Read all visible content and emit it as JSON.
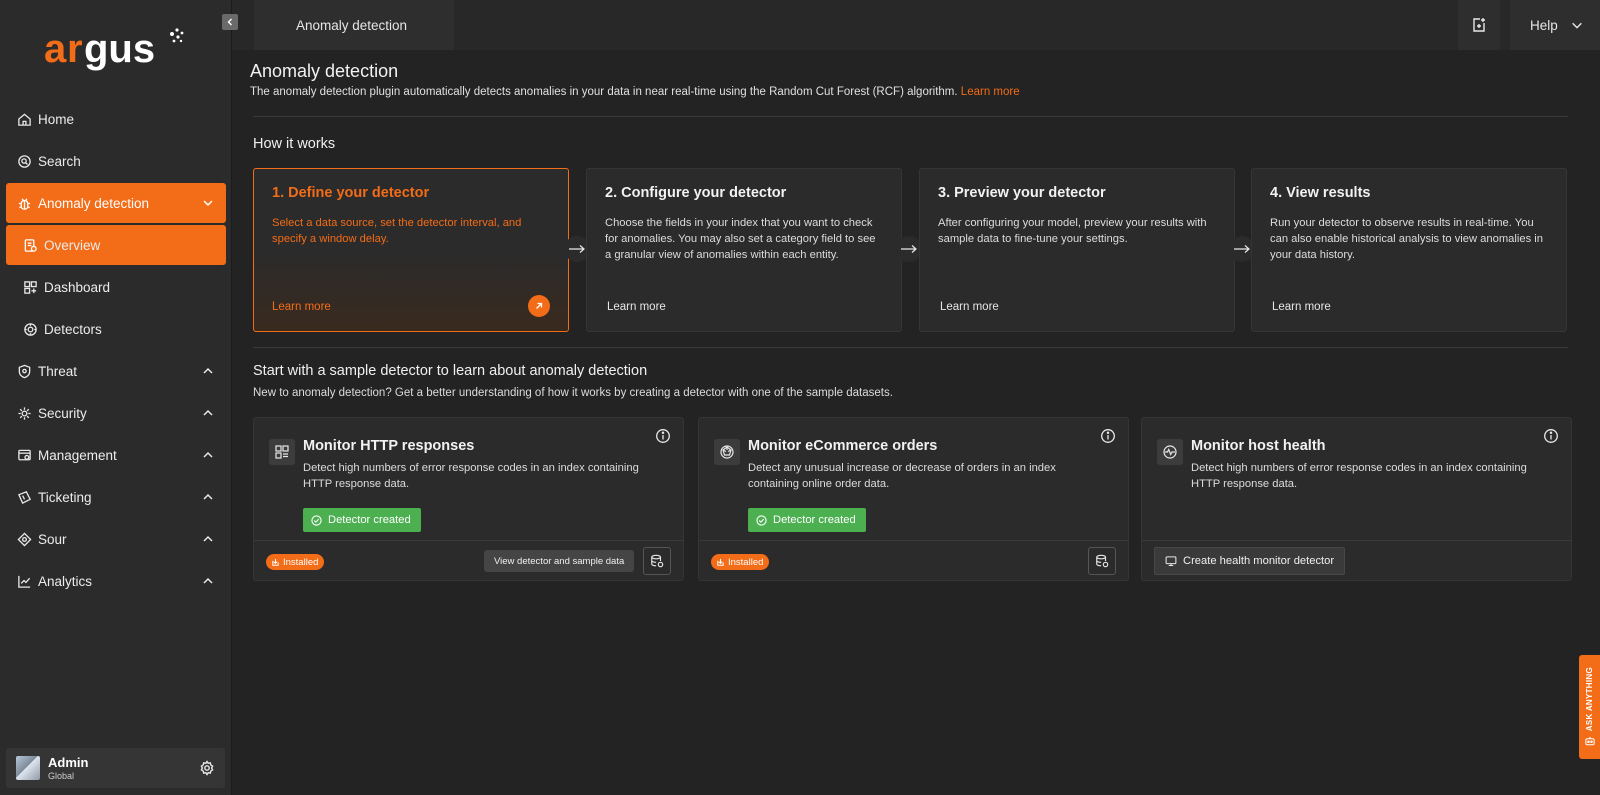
{
  "app": {
    "logo_text": "argus"
  },
  "sidebar": {
    "items": [
      {
        "label": "Home",
        "icon": "home-icon"
      },
      {
        "label": "Search",
        "icon": "search-icon"
      },
      {
        "label": "Anomaly detection",
        "icon": "bug-icon",
        "expanded": true
      },
      {
        "label": "Overview",
        "icon": "overview-icon"
      },
      {
        "label": "Dashboard",
        "icon": "dashboard-icon"
      },
      {
        "label": "Detectors",
        "icon": "detectors-icon"
      },
      {
        "label": "Threat",
        "icon": "shield-icon"
      },
      {
        "label": "Security",
        "icon": "security-icon"
      },
      {
        "label": "Management",
        "icon": "management-icon"
      },
      {
        "label": "Ticketing",
        "icon": "ticket-icon"
      },
      {
        "label": "Sour",
        "icon": "source-icon"
      },
      {
        "label": "Analytics",
        "icon": "analytics-icon"
      }
    ],
    "user": {
      "name": "Admin",
      "role": "Global"
    }
  },
  "topbar": {
    "tab_label": "Anomaly detection",
    "help_label": "Help"
  },
  "main": {
    "title": "Anomaly detection",
    "description": "The anomaly detection plugin automatically detects anomalies in your data in near real-time using the Random Cut Forest (RCF) algorithm.",
    "description_link": "Learn more",
    "how_title": "How it works",
    "steps": [
      {
        "title": "1. Define your detector",
        "text": "Select a data source, set the detector interval, and specify a window delay.",
        "link": "Learn more"
      },
      {
        "title": "2. Configure your detector",
        "text": "Choose the fields in your index that you want to check for anomalies. You may also set a category field to see a granular view of anomalies within each entity.",
        "link": "Learn more"
      },
      {
        "title": "3. Preview your detector",
        "text": "After configuring your model, preview your results with sample data to fine-tune your settings.",
        "link": "Learn more"
      },
      {
        "title": "4. View results",
        "text": "Run your detector to observe results in real-time. You can also enable historical analysis to view anomalies in your data history.",
        "link": "Learn more"
      }
    ],
    "sample_title": "Start with a sample detector to learn about anomaly detection",
    "sample_desc": "New to anomaly detection? Get a better understanding of how it works by creating a detector with one of the sample datasets.",
    "samples": [
      {
        "title": "Monitor HTTP responses",
        "text": "Detect high numbers of error response codes in an index containing HTTP response data.",
        "status": "Detector created",
        "badge": "Installed",
        "tooltip": "View detector and sample data"
      },
      {
        "title": "Monitor eCommerce orders",
        "text": "Detect any unusual increase or decrease of orders in an index containing online order data.",
        "status": "Detector created",
        "badge": "Installed"
      },
      {
        "title": "Monitor host health",
        "text": "Detect high numbers of error response codes in an index containing HTTP response data.",
        "button": "Create health monitor detector"
      }
    ]
  },
  "ask_tab": "ASK ANYTHING",
  "colors": {
    "accent": "#f36c17",
    "success": "#4caf50",
    "background": "#232323",
    "panel": "#2b2b2b"
  }
}
